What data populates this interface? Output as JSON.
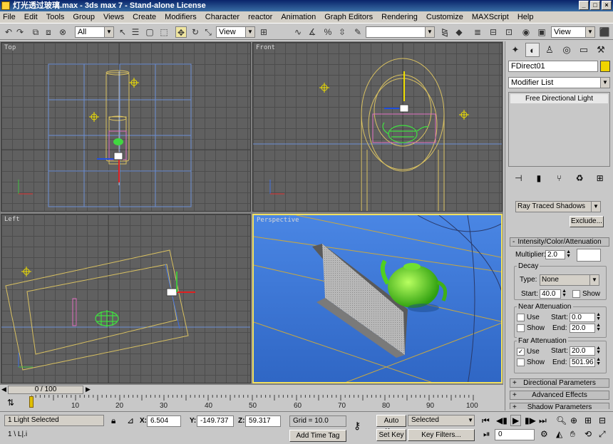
{
  "window": {
    "title": "灯光透过玻璃.max - 3ds max 7 - Stand-alone License",
    "btn_min": "_",
    "btn_max": "□",
    "btn_close": "×"
  },
  "menu": [
    "File",
    "Edit",
    "Tools",
    "Group",
    "Views",
    "Create",
    "Modifiers",
    "Character",
    "reactor",
    "Animation",
    "Graph Editors",
    "Rendering",
    "Customize",
    "MAXScript",
    "Help"
  ],
  "toolbar": {
    "selection_filter": "All",
    "ref_coord": "View",
    "named_selection": "",
    "view_dropdown": "View"
  },
  "viewports": {
    "top": "Top",
    "front": "Front",
    "left": "Left",
    "perspective": "Perspective"
  },
  "command_panel": {
    "object_name": "FDirect01",
    "object_color": "#f0d400",
    "modifier_list": "Modifier List",
    "stack_item": "Free Directional Light",
    "shadow_type": "Ray Traced Shadows",
    "exclude_button": "Exclude...",
    "intensity_header": "Intensity/Color/Attenuation",
    "multiplier_label": "Multiplier:",
    "multiplier_value": "2.0",
    "decay_label": "Decay",
    "decay_type_label": "Type:",
    "decay_type_value": "None",
    "decay_start_label": "Start:",
    "decay_start_value": "40.0",
    "show_label": "Show",
    "near_atten_label": "Near Attenuation",
    "use_label": "Use",
    "start_label": "Start:",
    "end_label": "End:",
    "near_start": "0.0",
    "near_end": "20.0",
    "far_atten_label": "Far Attenuation",
    "far_start": "20.0",
    "far_end": "501.96",
    "directional_header": "Directional Parameters",
    "advanced_header": "Advanced Effects",
    "shadow_header": "Shadow Parameters"
  },
  "timeline": {
    "frame_counter": "0 / 100",
    "ticks": [
      "10",
      "20",
      "30",
      "40",
      "50",
      "60",
      "70",
      "80",
      "90",
      "100"
    ]
  },
  "status": {
    "selection": "1 Light Selected",
    "prompt": "1 \\ L|.i",
    "x_label": "X:",
    "x_value": "6.504",
    "y_label": "Y:",
    "y_value": "-149.737",
    "z_label": "Z:",
    "z_value": "59.317",
    "grid": "Grid = 10.0",
    "add_time_tag": "Add Time Tag",
    "auto_key": "Auto Key",
    "set_key": "Set Key",
    "selected_dropdown": "Selected",
    "key_filters": "Key Filters...",
    "frame_field": "0"
  }
}
